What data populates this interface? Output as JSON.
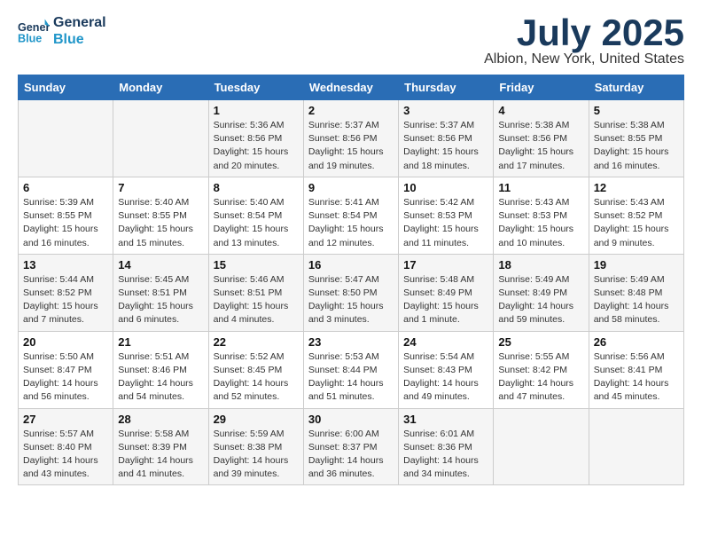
{
  "header": {
    "logo_line1": "General",
    "logo_line2": "Blue",
    "month": "July 2025",
    "location": "Albion, New York, United States"
  },
  "weekdays": [
    "Sunday",
    "Monday",
    "Tuesday",
    "Wednesday",
    "Thursday",
    "Friday",
    "Saturday"
  ],
  "weeks": [
    [
      {
        "day": "",
        "sunrise": "",
        "sunset": "",
        "daylight": ""
      },
      {
        "day": "",
        "sunrise": "",
        "sunset": "",
        "daylight": ""
      },
      {
        "day": "1",
        "sunrise": "Sunrise: 5:36 AM",
        "sunset": "Sunset: 8:56 PM",
        "daylight": "Daylight: 15 hours and 20 minutes."
      },
      {
        "day": "2",
        "sunrise": "Sunrise: 5:37 AM",
        "sunset": "Sunset: 8:56 PM",
        "daylight": "Daylight: 15 hours and 19 minutes."
      },
      {
        "day": "3",
        "sunrise": "Sunrise: 5:37 AM",
        "sunset": "Sunset: 8:56 PM",
        "daylight": "Daylight: 15 hours and 18 minutes."
      },
      {
        "day": "4",
        "sunrise": "Sunrise: 5:38 AM",
        "sunset": "Sunset: 8:56 PM",
        "daylight": "Daylight: 15 hours and 17 minutes."
      },
      {
        "day": "5",
        "sunrise": "Sunrise: 5:38 AM",
        "sunset": "Sunset: 8:55 PM",
        "daylight": "Daylight: 15 hours and 16 minutes."
      }
    ],
    [
      {
        "day": "6",
        "sunrise": "Sunrise: 5:39 AM",
        "sunset": "Sunset: 8:55 PM",
        "daylight": "Daylight: 15 hours and 16 minutes."
      },
      {
        "day": "7",
        "sunrise": "Sunrise: 5:40 AM",
        "sunset": "Sunset: 8:55 PM",
        "daylight": "Daylight: 15 hours and 15 minutes."
      },
      {
        "day": "8",
        "sunrise": "Sunrise: 5:40 AM",
        "sunset": "Sunset: 8:54 PM",
        "daylight": "Daylight: 15 hours and 13 minutes."
      },
      {
        "day": "9",
        "sunrise": "Sunrise: 5:41 AM",
        "sunset": "Sunset: 8:54 PM",
        "daylight": "Daylight: 15 hours and 12 minutes."
      },
      {
        "day": "10",
        "sunrise": "Sunrise: 5:42 AM",
        "sunset": "Sunset: 8:53 PM",
        "daylight": "Daylight: 15 hours and 11 minutes."
      },
      {
        "day": "11",
        "sunrise": "Sunrise: 5:43 AM",
        "sunset": "Sunset: 8:53 PM",
        "daylight": "Daylight: 15 hours and 10 minutes."
      },
      {
        "day": "12",
        "sunrise": "Sunrise: 5:43 AM",
        "sunset": "Sunset: 8:52 PM",
        "daylight": "Daylight: 15 hours and 9 minutes."
      }
    ],
    [
      {
        "day": "13",
        "sunrise": "Sunrise: 5:44 AM",
        "sunset": "Sunset: 8:52 PM",
        "daylight": "Daylight: 15 hours and 7 minutes."
      },
      {
        "day": "14",
        "sunrise": "Sunrise: 5:45 AM",
        "sunset": "Sunset: 8:51 PM",
        "daylight": "Daylight: 15 hours and 6 minutes."
      },
      {
        "day": "15",
        "sunrise": "Sunrise: 5:46 AM",
        "sunset": "Sunset: 8:51 PM",
        "daylight": "Daylight: 15 hours and 4 minutes."
      },
      {
        "day": "16",
        "sunrise": "Sunrise: 5:47 AM",
        "sunset": "Sunset: 8:50 PM",
        "daylight": "Daylight: 15 hours and 3 minutes."
      },
      {
        "day": "17",
        "sunrise": "Sunrise: 5:48 AM",
        "sunset": "Sunset: 8:49 PM",
        "daylight": "Daylight: 15 hours and 1 minute."
      },
      {
        "day": "18",
        "sunrise": "Sunrise: 5:49 AM",
        "sunset": "Sunset: 8:49 PM",
        "daylight": "Daylight: 14 hours and 59 minutes."
      },
      {
        "day": "19",
        "sunrise": "Sunrise: 5:49 AM",
        "sunset": "Sunset: 8:48 PM",
        "daylight": "Daylight: 14 hours and 58 minutes."
      }
    ],
    [
      {
        "day": "20",
        "sunrise": "Sunrise: 5:50 AM",
        "sunset": "Sunset: 8:47 PM",
        "daylight": "Daylight: 14 hours and 56 minutes."
      },
      {
        "day": "21",
        "sunrise": "Sunrise: 5:51 AM",
        "sunset": "Sunset: 8:46 PM",
        "daylight": "Daylight: 14 hours and 54 minutes."
      },
      {
        "day": "22",
        "sunrise": "Sunrise: 5:52 AM",
        "sunset": "Sunset: 8:45 PM",
        "daylight": "Daylight: 14 hours and 52 minutes."
      },
      {
        "day": "23",
        "sunrise": "Sunrise: 5:53 AM",
        "sunset": "Sunset: 8:44 PM",
        "daylight": "Daylight: 14 hours and 51 minutes."
      },
      {
        "day": "24",
        "sunrise": "Sunrise: 5:54 AM",
        "sunset": "Sunset: 8:43 PM",
        "daylight": "Daylight: 14 hours and 49 minutes."
      },
      {
        "day": "25",
        "sunrise": "Sunrise: 5:55 AM",
        "sunset": "Sunset: 8:42 PM",
        "daylight": "Daylight: 14 hours and 47 minutes."
      },
      {
        "day": "26",
        "sunrise": "Sunrise: 5:56 AM",
        "sunset": "Sunset: 8:41 PM",
        "daylight": "Daylight: 14 hours and 45 minutes."
      }
    ],
    [
      {
        "day": "27",
        "sunrise": "Sunrise: 5:57 AM",
        "sunset": "Sunset: 8:40 PM",
        "daylight": "Daylight: 14 hours and 43 minutes."
      },
      {
        "day": "28",
        "sunrise": "Sunrise: 5:58 AM",
        "sunset": "Sunset: 8:39 PM",
        "daylight": "Daylight: 14 hours and 41 minutes."
      },
      {
        "day": "29",
        "sunrise": "Sunrise: 5:59 AM",
        "sunset": "Sunset: 8:38 PM",
        "daylight": "Daylight: 14 hours and 39 minutes."
      },
      {
        "day": "30",
        "sunrise": "Sunrise: 6:00 AM",
        "sunset": "Sunset: 8:37 PM",
        "daylight": "Daylight: 14 hours and 36 minutes."
      },
      {
        "day": "31",
        "sunrise": "Sunrise: 6:01 AM",
        "sunset": "Sunset: 8:36 PM",
        "daylight": "Daylight: 14 hours and 34 minutes."
      },
      {
        "day": "",
        "sunrise": "",
        "sunset": "",
        "daylight": ""
      },
      {
        "day": "",
        "sunrise": "",
        "sunset": "",
        "daylight": ""
      }
    ]
  ]
}
